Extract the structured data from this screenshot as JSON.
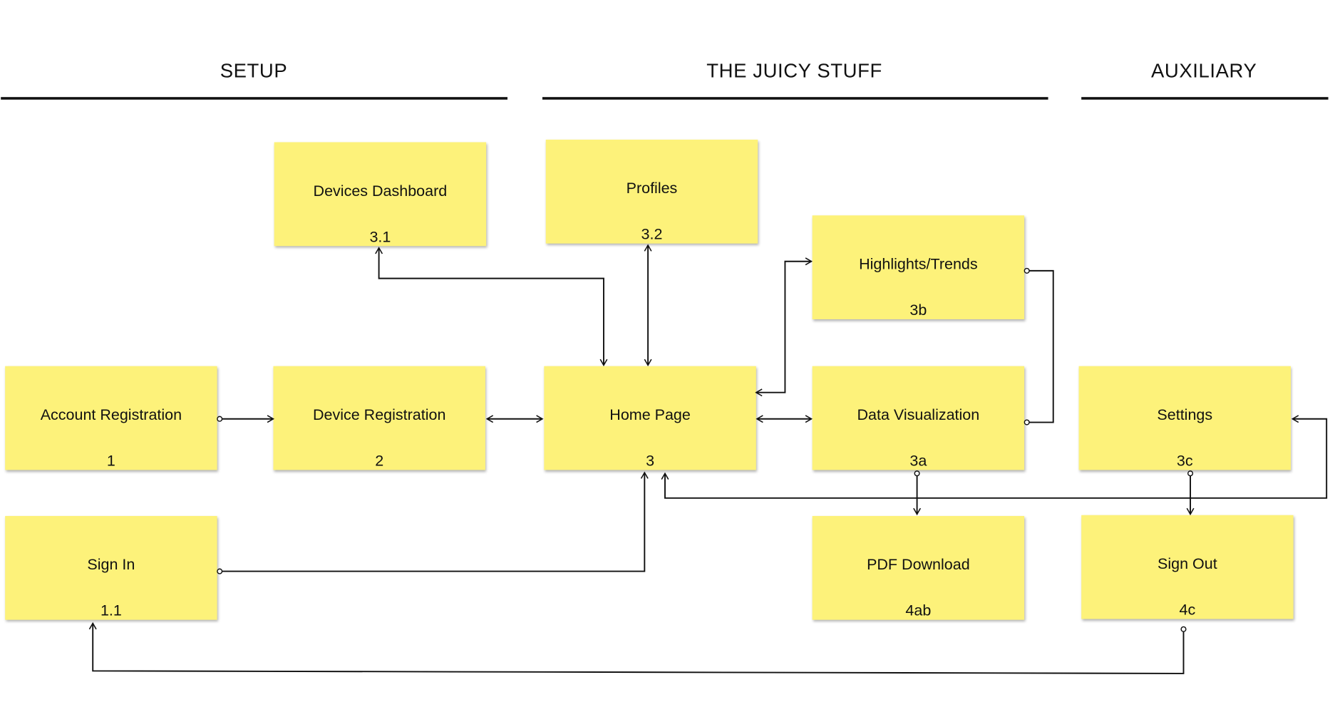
{
  "sections": [
    {
      "label": "SETUP"
    },
    {
      "label": "THE JUICY STUFF"
    },
    {
      "label": "AUXILIARY"
    }
  ],
  "nodes": {
    "devices_dashboard": {
      "title": "Devices Dashboard",
      "id": "3.1"
    },
    "profiles": {
      "title": "Profiles",
      "id": "3.2"
    },
    "highlights": {
      "title": "Highlights/Trends",
      "id": "3b"
    },
    "account_registration": {
      "title": "Account Registration",
      "id": "1"
    },
    "device_registration": {
      "title": "Device Registration",
      "id": "2"
    },
    "home_page": {
      "title": "Home Page",
      "id": "3"
    },
    "data_visualization": {
      "title": "Data Visualization",
      "id": "3a"
    },
    "settings": {
      "title": "Settings",
      "id": "3c"
    },
    "sign_in": {
      "title": "Sign In",
      "id": "1.1"
    },
    "pdf_download": {
      "title": "PDF Download",
      "id": "4ab"
    },
    "sign_out": {
      "title": "Sign Out",
      "id": "4c"
    }
  },
  "colors": {
    "note": "#fdf27a",
    "line": "#111111"
  }
}
